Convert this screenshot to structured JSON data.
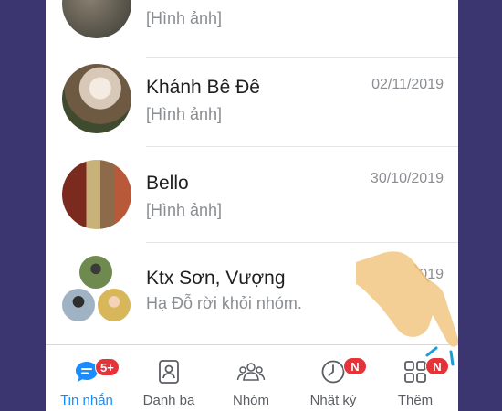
{
  "conversations": [
    {
      "name": "",
      "preview": "[Hình ảnh]",
      "date": ""
    },
    {
      "name": "Khánh Bê Đê",
      "preview": "[Hình ảnh]",
      "date": "02/11/2019"
    },
    {
      "name": "Bello",
      "preview": "[Hình ảnh]",
      "date": "30/10/2019"
    },
    {
      "name": "Ktx Sơn, Vượng",
      "preview": "Hạ Đỗ rời khỏi nhóm.",
      "date": "10/2019"
    }
  ],
  "tabs": [
    {
      "label": "Tin nhắn",
      "icon": "chat-bubble-icon",
      "badge": "5+",
      "active": true
    },
    {
      "label": "Danh bạ",
      "icon": "contacts-icon",
      "badge": "",
      "active": false
    },
    {
      "label": "Nhóm",
      "icon": "group-icon",
      "badge": "",
      "active": false
    },
    {
      "label": "Nhật ký",
      "icon": "clock-icon",
      "badge": "N",
      "active": false
    },
    {
      "label": "Thêm",
      "icon": "grid-icon",
      "badge": "N",
      "active": false
    }
  ],
  "colors": {
    "background": "#3b3570",
    "accent": "#1a8cff",
    "badge": "#e5333a",
    "hand": "#f3cf96"
  }
}
